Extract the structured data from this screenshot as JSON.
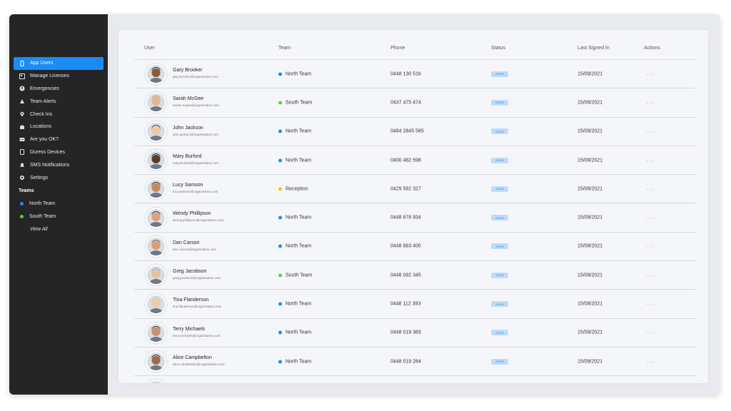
{
  "sidebar": {
    "nav": [
      {
        "label": "App Users",
        "icon": "phone-icon",
        "active": true
      },
      {
        "label": "Manage Licenses",
        "icon": "license-icon",
        "active": false
      },
      {
        "label": "Emergencies",
        "icon": "emergency-icon",
        "active": false
      },
      {
        "label": "Team Alerts",
        "icon": "alert-icon",
        "active": false
      },
      {
        "label": "Check Ins",
        "icon": "location-pin-icon",
        "active": false
      },
      {
        "label": "Locations",
        "icon": "building-icon",
        "active": false
      },
      {
        "label": "Are you OK?",
        "icon": "chat-icon",
        "active": false
      },
      {
        "label": "Duress Devices",
        "icon": "device-icon",
        "active": false
      },
      {
        "label": "SMS Notifications",
        "icon": "bell-icon",
        "active": false
      },
      {
        "label": "Settings",
        "icon": "gear-icon",
        "active": false
      }
    ],
    "teams_heading": "Teams",
    "teams": [
      {
        "label": "North Team",
        "color": "#1b8cf6"
      },
      {
        "label": "South Team",
        "color": "#5ed321"
      }
    ],
    "view_all": "View All"
  },
  "table": {
    "headers": {
      "user": "User",
      "team": "Team",
      "phone": "Phone",
      "status": "Status",
      "last_signed_in": "Last Signed In",
      "actions": "Actions"
    },
    "actions_glyph": "···",
    "rows": [
      {
        "name": "Gary Brooker",
        "email": "gary.brooker@organisation.com",
        "team": "North Team",
        "team_color": "#1b8cf6",
        "phone": "0448 130 516",
        "status": "Active",
        "last": "15/09/2021"
      },
      {
        "name": "Sarah McGee",
        "email": "sarah.mcgee@organisation.com",
        "team": "South Team",
        "team_color": "#5ed321",
        "phone": "0437 475 474",
        "status": "Active",
        "last": "15/09/2021"
      },
      {
        "name": "John Jackson",
        "email": "john.jackson@organisation.com",
        "team": "North Team",
        "team_color": "#1b8cf6",
        "phone": "0494 2845 585",
        "status": "Active",
        "last": "15/09/2021"
      },
      {
        "name": "Mary Burford",
        "email": "mary.burford@organisation.com",
        "team": "North Team",
        "team_color": "#1b8cf6",
        "phone": "0400 482 598",
        "status": "Active",
        "last": "15/09/2021"
      },
      {
        "name": "Lucy Samson",
        "email": "lucy.samson@organisation.com",
        "team": "Reception",
        "team_color": "#f5c518",
        "phone": "0429 592 327",
        "status": "Active",
        "last": "15/09/2021"
      },
      {
        "name": "Wendy Phillipson",
        "email": "wendy.phillipson@organisation.com",
        "team": "North Team",
        "team_color": "#1b8cf6",
        "phone": "0448  678 934",
        "status": "Active",
        "last": "15/09/2021"
      },
      {
        "name": "Dan Carson",
        "email": "dan.carson@organisation.com",
        "team": "North Team",
        "team_color": "#1b8cf6",
        "phone": "0448 883 400",
        "status": "Active",
        "last": "15/09/2021"
      },
      {
        "name": "Greg Jacobson",
        "email": "greg.jacobson@organisation.com",
        "team": "South Team",
        "team_color": "#5ed321",
        "phone": "0448 092 345",
        "status": "Active",
        "last": "15/09/2021"
      },
      {
        "name": "Tina Flanderson",
        "email": "tina.flanderson@organisation.com",
        "team": "North Team",
        "team_color": "#1b8cf6",
        "phone": "0448 112 393",
        "status": "Active",
        "last": "15/09/2021"
      },
      {
        "name": "Terry Michaels",
        "email": "terry.michaels@organisation.com",
        "team": "North Team",
        "team_color": "#1b8cf6",
        "phone": "0448 019 383",
        "status": "Active",
        "last": "15/09/2021"
      },
      {
        "name": "Alice Campbelton",
        "email": "alice.campbelton@organisation.com",
        "team": "North Team",
        "team_color": "#1b8cf6",
        "phone": "0448 019 284",
        "status": "Active",
        "last": "15/09/2021"
      },
      {
        "name": "",
        "email": "",
        "team": "",
        "team_color": "#1b8cf6",
        "phone": "",
        "status": "",
        "last": ""
      }
    ]
  }
}
